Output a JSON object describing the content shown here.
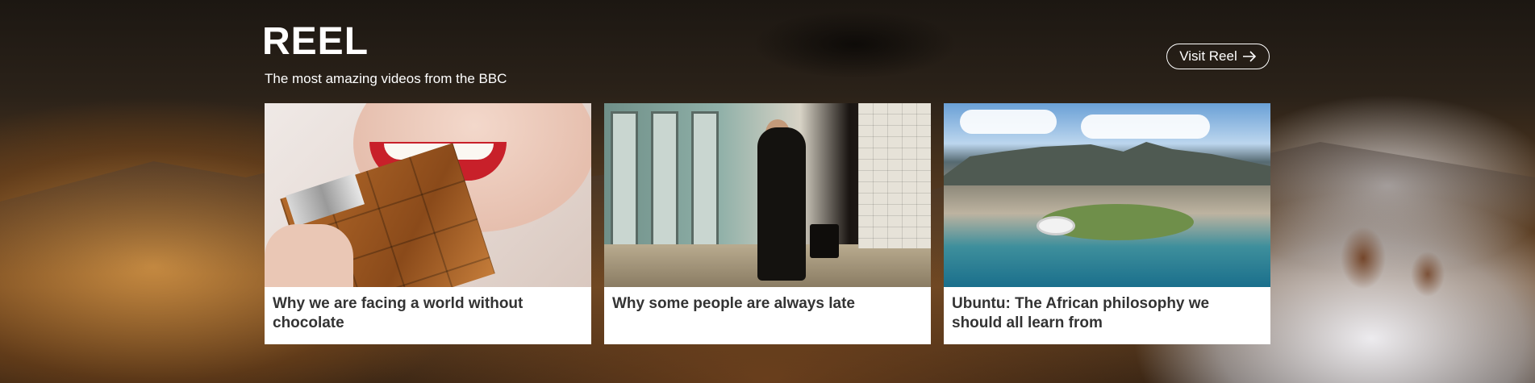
{
  "section": {
    "title": "REEL",
    "subtitle": "The most amazing videos from the BBC",
    "visit_button_label": "Visit Reel"
  },
  "cards": [
    {
      "title": "Why we are facing a world without chocolate",
      "image": "woman-biting-chocolate-bar"
    },
    {
      "title": "Why some people are always late",
      "image": "man-running-for-train"
    },
    {
      "title": "Ubuntu: The African philosophy we should all learn from",
      "image": "aerial-view-cape-town"
    }
  ],
  "icons": {
    "visit_button": "arrow-right-icon"
  },
  "colors": {
    "card_background": "#ffffff",
    "card_title_text": "#333333",
    "header_text": "#ffffff"
  }
}
